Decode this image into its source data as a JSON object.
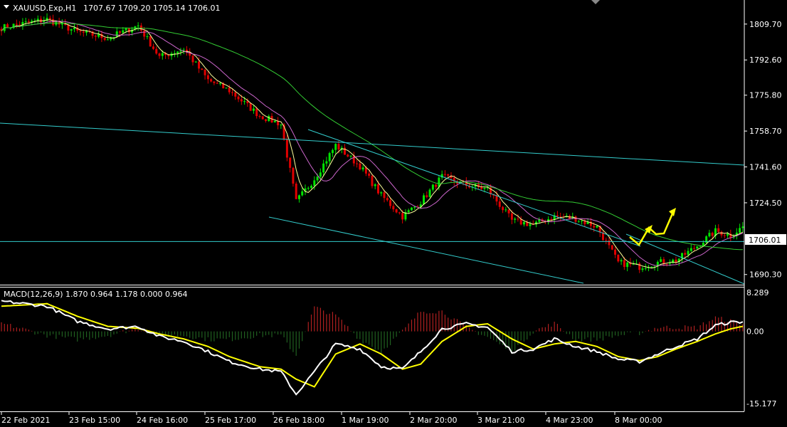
{
  "header": {
    "symbol_info": "XAUUSD.Exp,H1",
    "ohlc": "1707.67 1709.20 1705.14 1706.01"
  },
  "macd_header": "MACD(12,26,9) 1.870 0.964 1.178 0.000 0.964",
  "current_price_label": "1706.01",
  "colors": {
    "background": "#000000",
    "bull_candle": "#00e400",
    "bear_candle": "#e00000",
    "ma_fast": "#ffff99",
    "ma_mid": "#cc66cc",
    "ma_slow": "#33cc33",
    "trend_lines": "#33cccc",
    "forecast_arrow": "#ffff00",
    "macd_main": "#ffffff",
    "macd_signal": "#ffff00",
    "histogram_positive": "#b02020",
    "histogram_negative": "#206020"
  },
  "chart_data": [
    {
      "type": "candlestick",
      "symbol": "XAUUSD.Exp",
      "timeframe": "H1",
      "price_ticks": [
        "1809.70",
        "1792.60",
        "1775.80",
        "1758.70",
        "1741.60",
        "1724.50",
        "1690.30"
      ],
      "price_tick_values": [
        1809.7,
        1792.6,
        1775.8,
        1758.7,
        1741.6,
        1724.5,
        1690.3
      ],
      "ylim": [
        1685.8,
        1820.5
      ],
      "time_ticks": [
        "22 Feb 2021",
        "23 Feb 15:00",
        "24 Feb 16:00",
        "25 Feb 17:00",
        "26 Feb 18:00",
        "1 Mar 19:00",
        "2 Mar 20:00",
        "3 Mar 21:00",
        "4 Mar 23:00",
        "8 Mar 00:00"
      ],
      "last_price": 1706.01,
      "close_path": [
        [
          0,
          1808
        ],
        [
          15,
          1812
        ],
        [
          25,
          1806
        ],
        [
          35,
          1803
        ],
        [
          45,
          1809
        ],
        [
          52,
          1794
        ],
        [
          60,
          1798
        ],
        [
          68,
          1783
        ],
        [
          75,
          1778
        ],
        [
          85,
          1766
        ],
        [
          92,
          1762
        ],
        [
          97,
          1725
        ],
        [
          103,
          1736
        ],
        [
          110,
          1752
        ],
        [
          118,
          1742
        ],
        [
          125,
          1728
        ],
        [
          132,
          1718
        ],
        [
          138,
          1725
        ],
        [
          145,
          1737
        ],
        [
          153,
          1733
        ],
        [
          160,
          1731
        ],
        [
          168,
          1716
        ],
        [
          175,
          1714
        ],
        [
          182,
          1718
        ],
        [
          189,
          1717
        ],
        [
          196,
          1713
        ],
        [
          203,
          1696
        ],
        [
          210,
          1694
        ],
        [
          216,
          1696
        ],
        [
          222,
          1697
        ],
        [
          229,
          1704
        ],
        [
          235,
          1711
        ],
        [
          240,
          1709
        ],
        [
          244,
          1713
        ]
      ],
      "overlay_lines": [
        "moving average (fast)",
        "moving average (mid)",
        "moving average (slow)",
        "upper channel line",
        "lower channel line",
        "long-term resistance line",
        "current price line",
        "forecast arrow"
      ]
    },
    {
      "type": "macd",
      "title": "MACD(12,26,9) 1.870 0.964 1.178 0.000 0.964",
      "ticks": [
        "8.289",
        "0.00",
        "-15.177"
      ],
      "tick_values": [
        8.289,
        0,
        -15.177
      ],
      "ylim": [
        -15.177,
        8.289
      ],
      "main_path": [
        [
          0,
          6
        ],
        [
          15,
          5
        ],
        [
          25,
          2
        ],
        [
          35,
          0.5
        ],
        [
          45,
          1
        ],
        [
          52,
          -1
        ],
        [
          60,
          -2
        ],
        [
          68,
          -4
        ],
        [
          75,
          -6
        ],
        [
          85,
          -7.5
        ],
        [
          92,
          -8
        ],
        [
          97,
          -12.5
        ],
        [
          103,
          -8
        ],
        [
          110,
          -2.5
        ],
        [
          118,
          -3.5
        ],
        [
          125,
          -7
        ],
        [
          132,
          -7.5
        ],
        [
          138,
          -4
        ],
        [
          145,
          0.5
        ],
        [
          153,
          1.5
        ],
        [
          160,
          0.8
        ],
        [
          168,
          -4
        ],
        [
          175,
          -3.5
        ],
        [
          182,
          -1.5
        ],
        [
          189,
          -3
        ],
        [
          196,
          -4
        ],
        [
          203,
          -5.5
        ],
        [
          210,
          -6
        ],
        [
          216,
          -4.5
        ],
        [
          222,
          -3
        ],
        [
          229,
          -1.5
        ],
        [
          235,
          1.2
        ],
        [
          240,
          1.8
        ],
        [
          244,
          1.9
        ]
      ],
      "signal_path": [
        [
          0,
          5
        ],
        [
          15,
          5.5
        ],
        [
          25,
          3
        ],
        [
          35,
          1
        ],
        [
          45,
          0.6
        ],
        [
          52,
          -0.5
        ],
        [
          60,
          -1.5
        ],
        [
          68,
          -3
        ],
        [
          75,
          -5
        ],
        [
          85,
          -7
        ],
        [
          92,
          -7.5
        ],
        [
          97,
          -9.5
        ],
        [
          103,
          -11
        ],
        [
          110,
          -4.5
        ],
        [
          118,
          -2.5
        ],
        [
          125,
          -4.5
        ],
        [
          132,
          -7.5
        ],
        [
          138,
          -6.5
        ],
        [
          145,
          -2
        ],
        [
          153,
          1
        ],
        [
          160,
          1.5
        ],
        [
          168,
          -1.5
        ],
        [
          175,
          -3.5
        ],
        [
          182,
          -2.5
        ],
        [
          189,
          -2
        ],
        [
          196,
          -3
        ],
        [
          203,
          -5
        ],
        [
          210,
          -5.8
        ],
        [
          216,
          -5
        ],
        [
          222,
          -3.5
        ],
        [
          229,
          -2
        ],
        [
          235,
          -0.5
        ],
        [
          240,
          0.5
        ],
        [
          244,
          1
        ]
      ],
      "series": [
        {
          "name": "MACD",
          "color": "#ffffff"
        },
        {
          "name": "Signal",
          "color": "#ffff00"
        },
        {
          "name": "Histogram",
          "color": "#b02020"
        }
      ]
    }
  ]
}
